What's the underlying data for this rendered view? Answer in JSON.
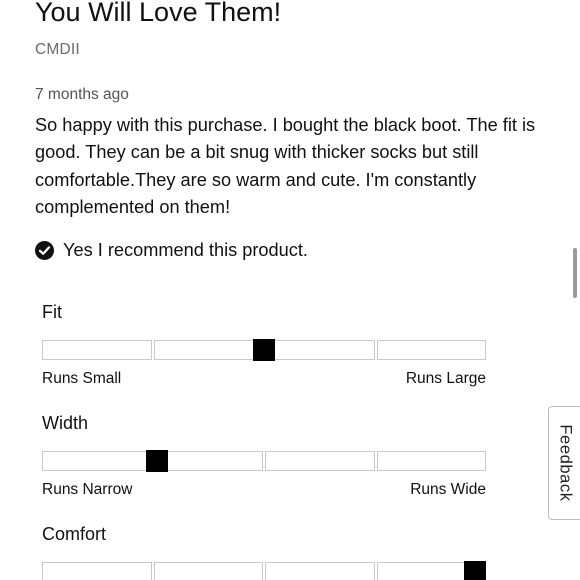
{
  "review": {
    "title": "You Will Love Them!",
    "reviewer": "CMDII",
    "date": "7 months ago",
    "body": "So happy with this purchase. I bought the black boot. The fit is good. They can be a bit snug with thicker socks but still comfortable.They are so warm and cute. I'm constantly complemented on them!",
    "recommend_text": "Yes I recommend this product."
  },
  "ratings": [
    {
      "label": "Fit",
      "low": "Runs Small",
      "high": "Runs Large",
      "segments": 4,
      "marker_position": 0.5
    },
    {
      "label": "Width",
      "low": "Runs Narrow",
      "high": "Runs Wide",
      "segments": 4,
      "marker_position": 0.26
    },
    {
      "label": "Comfort",
      "low": "",
      "high": "",
      "segments": 4,
      "marker_position": 0.98
    }
  ],
  "feedback_tab": {
    "label": "Feedback"
  },
  "colors": {
    "marker": "#000000",
    "segment_border": "#c9c9c9",
    "muted_text": "#6b6b6b"
  }
}
